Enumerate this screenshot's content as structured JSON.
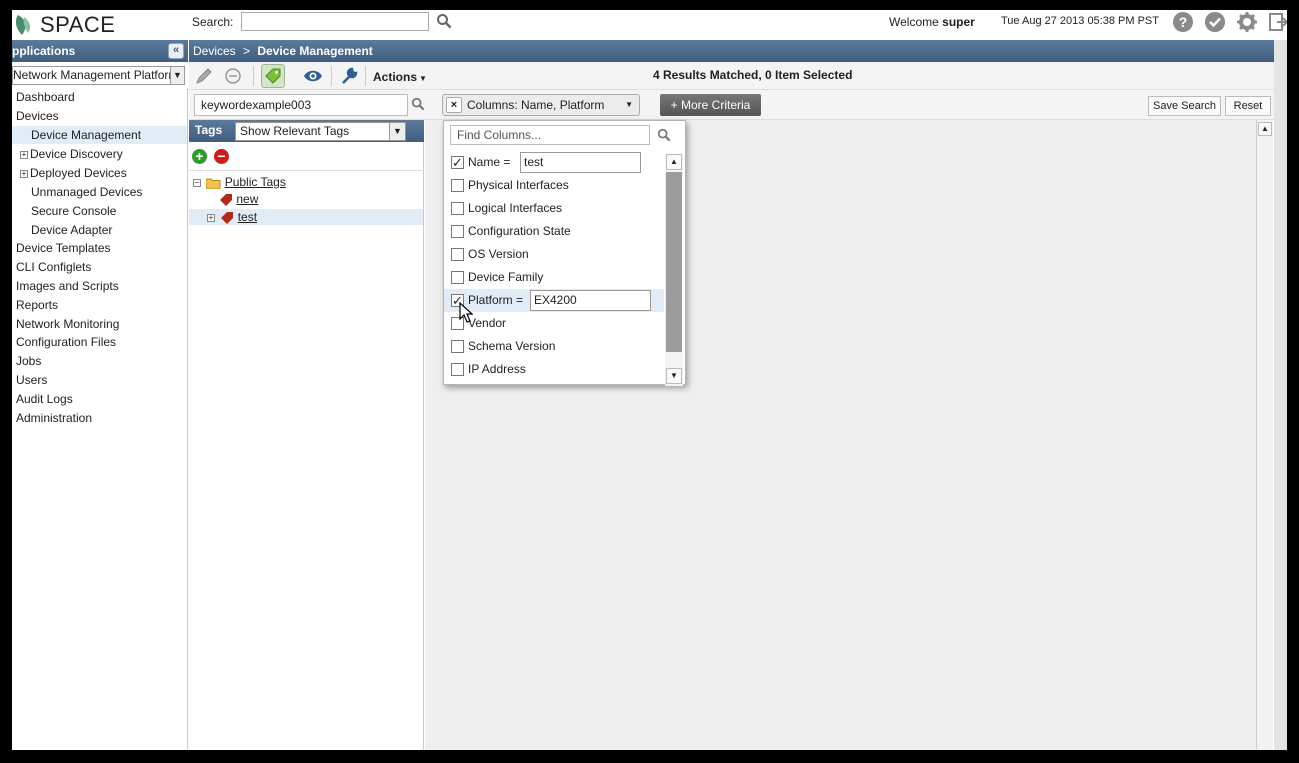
{
  "header": {
    "logo_text": "SPACE",
    "search_label": "Search:",
    "search_value": "",
    "welcome_prefix": "Welcome",
    "username": "super",
    "datetime": "Tue Aug 27 2013 05:38 PM PST",
    "help_glyph": "?",
    "icons": [
      "help-icon",
      "check-icon",
      "gear-icon",
      "logout-icon"
    ]
  },
  "sidebar": {
    "title": "pplications",
    "platform": "Network Management Platform",
    "items": [
      {
        "label": "Dashboard"
      },
      {
        "label": "Devices"
      },
      {
        "label": "Device Management"
      },
      {
        "label": "Device Discovery"
      },
      {
        "label": "Deployed Devices"
      },
      {
        "label": "Unmanaged Devices"
      },
      {
        "label": "Secure Console"
      },
      {
        "label": "Device Adapter"
      },
      {
        "label": "Device Templates"
      },
      {
        "label": "CLI Configlets"
      },
      {
        "label": "Images and Scripts"
      },
      {
        "label": "Reports"
      },
      {
        "label": "Network Monitoring"
      },
      {
        "label": "Configuration Files"
      },
      {
        "label": "Jobs"
      },
      {
        "label": "Users"
      },
      {
        "label": "Audit Logs"
      },
      {
        "label": "Administration"
      }
    ]
  },
  "breadcrumb": {
    "parent": "Devices",
    "separator": ">",
    "current": "Device Management"
  },
  "toolbar": {
    "actions_label": "Actions",
    "results_text": "4 Results Matched, 0 Item Selected"
  },
  "filter": {
    "keyword": "keywordexample003",
    "columns_chip": "Columns: Name, Platform",
    "clear_glyph": "×",
    "more_criteria": "More Criteria",
    "save_search": "Save Search",
    "reset": "Reset"
  },
  "tags": {
    "title": "Tags",
    "filter_value": "Show Relevant Tags",
    "add_glyph": "+",
    "remove_glyph": "−",
    "tree": {
      "root": "Public Tags",
      "children": [
        {
          "label": "new"
        },
        {
          "label": "test"
        }
      ]
    }
  },
  "columns_dropdown": {
    "find_placeholder": "Find Columns...",
    "options": [
      {
        "label": "Name =",
        "checked": true,
        "value": "test"
      },
      {
        "label": "Physical Interfaces",
        "checked": false
      },
      {
        "label": "Logical Interfaces",
        "checked": false
      },
      {
        "label": "Configuration State",
        "checked": false
      },
      {
        "label": "OS Version",
        "checked": false
      },
      {
        "label": "Device Family",
        "checked": false
      },
      {
        "label": "Platform =",
        "checked": true,
        "value": "EX4200"
      },
      {
        "label": "Vendor",
        "checked": false
      },
      {
        "label": "Schema Version",
        "checked": false
      },
      {
        "label": "IP Address",
        "checked": false
      }
    ]
  },
  "colors": {
    "header_blue": "#3f5e80",
    "selection": "#e2ecf6",
    "add_green": "#2a9d2a",
    "remove_red": "#d11c1c"
  }
}
